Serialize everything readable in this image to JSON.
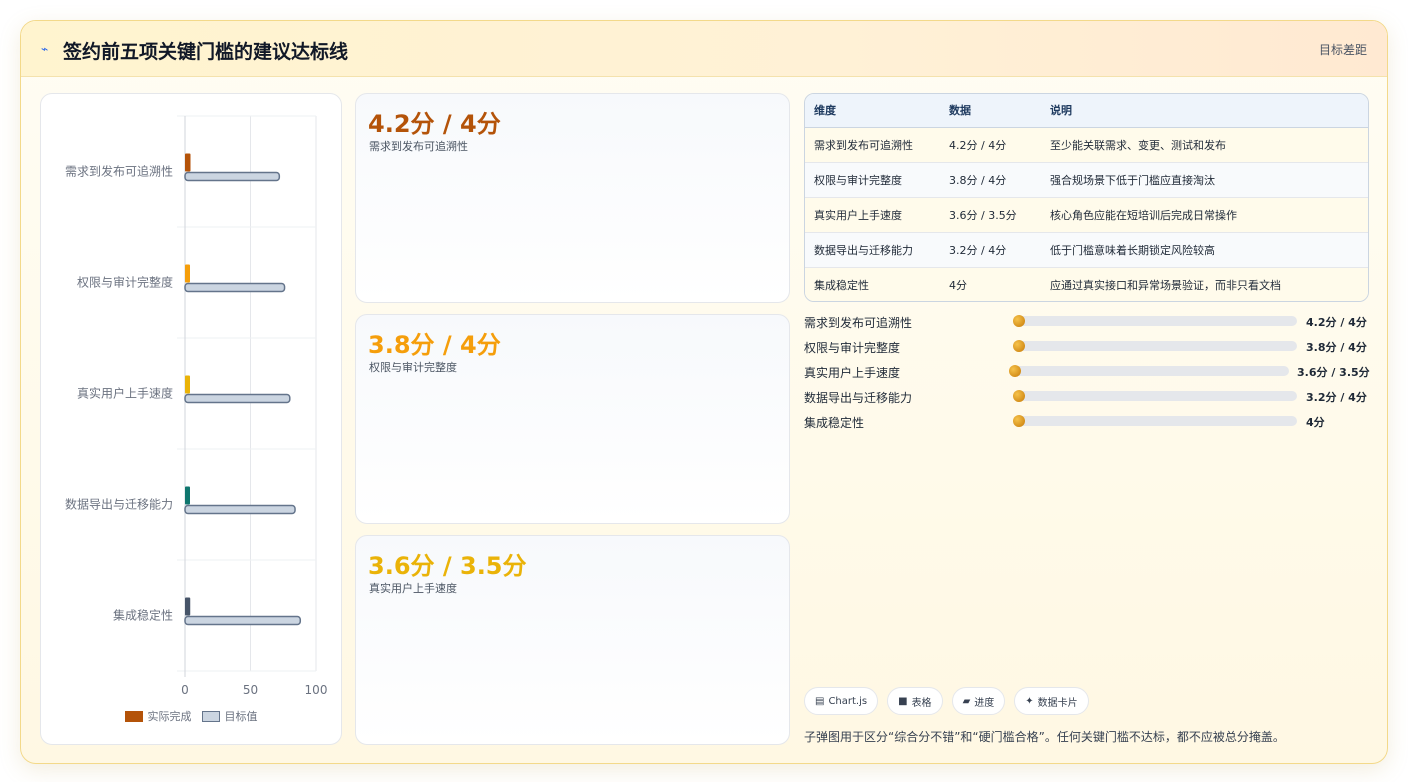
{
  "header": {
    "title": "签约前五项关键门槛的建议达标线",
    "title_icon": "chart-line-icon",
    "right_label": "目标差距"
  },
  "chart_data": {
    "type": "bar",
    "orientation": "horizontal",
    "categories": [
      "需求到发布可追溯性",
      "权限与审计完整度",
      "真实用户上手速度",
      "数据导出与迁移能力",
      "集成稳定性"
    ],
    "series": [
      {
        "name": "实际完成",
        "values": [
          4.2,
          3.8,
          3.6,
          3.2,
          4
        ],
        "colors": [
          "#b45309",
          "#f59e0b",
          "#eab308",
          "#0f766e",
          "#475569"
        ]
      },
      {
        "name": "目标值",
        "values": [
          72,
          76,
          80,
          84,
          88
        ],
        "color": "#cbd5e1",
        "border": "#64748b"
      }
    ],
    "xlim": [
      0,
      100
    ],
    "xticks": [
      "0",
      "50",
      "100"
    ],
    "grid": true,
    "legend_position": "bottom"
  },
  "cards": [
    {
      "value": "4.2分 / 4分",
      "label": "需求到发布可追溯性",
      "color": "#b45309"
    },
    {
      "value": "3.8分 / 4分",
      "label": "权限与审计完整度",
      "color": "#f59e0b"
    },
    {
      "value": "3.6分 / 3.5分",
      "label": "真实用户上手速度",
      "color": "#eab308"
    }
  ],
  "table": {
    "headers": [
      "维度",
      "数据",
      "说明"
    ],
    "rows": [
      [
        "需求到发布可追溯性",
        "4.2分 / 4分",
        "至少能关联需求、变更、测试和发布"
      ],
      [
        "权限与审计完整度",
        "3.8分 / 4分",
        "强合规场景下低于门槛应直接淘汰"
      ],
      [
        "真实用户上手速度",
        "3.6分 / 3.5分",
        "核心角色应能在短培训后完成日常操作"
      ],
      [
        "数据导出与迁移能力",
        "3.2分 / 4分",
        "低于门槛意味着长期锁定风险较高"
      ],
      [
        "集成稳定性",
        "4分",
        "应通过真实接口和异常场景验证，而非只看文档"
      ]
    ]
  },
  "progress": [
    {
      "label": "需求到发布可追溯性",
      "value": "4.2分 / 4分",
      "fraction": 0.0
    },
    {
      "label": "权限与审计完整度",
      "value": "3.8分 / 4分",
      "fraction": 0.0
    },
    {
      "label": "真实用户上手速度",
      "value": "3.6分 / 3.5分",
      "fraction": 0.0
    },
    {
      "label": "数据导出与迁移能力",
      "value": "3.2分 / 4分",
      "fraction": 0.0
    },
    {
      "label": "集成稳定性",
      "value": "4分",
      "fraction": 0.0
    }
  ],
  "chips": [
    {
      "icon": "chart-icon",
      "glyph": "▤",
      "label": "Chart.js"
    },
    {
      "icon": "table-icon",
      "glyph": "■",
      "label": "表格"
    },
    {
      "icon": "progress-icon",
      "glyph": "▰",
      "label": "进度"
    },
    {
      "icon": "sparkle-icon",
      "glyph": "✦",
      "label": "数据卡片"
    }
  ],
  "footnote": "子弹图用于区分“综合分不错”和“硬门槛合格”。任何关键门槛不达标，都不应被总分掩盖。"
}
